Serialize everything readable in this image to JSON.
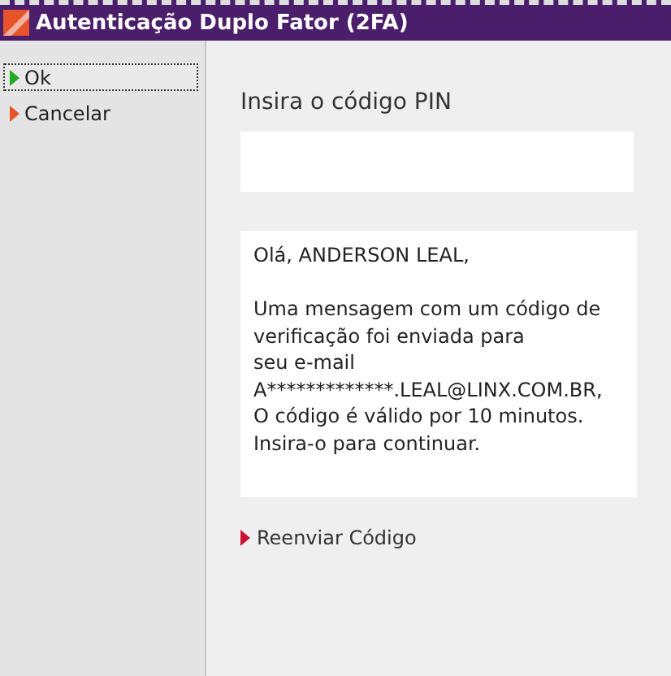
{
  "window": {
    "title": "Autenticação Duplo Fator (2FA)"
  },
  "sidebar": {
    "items": [
      {
        "label": "Ok",
        "color": "#22aa22",
        "selected": true
      },
      {
        "label": "Cancelar",
        "color": "#e8542a",
        "selected": false
      }
    ]
  },
  "pin": {
    "label": "Insira o código PIN"
  },
  "message": {
    "greeting": "Olá, ANDERSON LEAL,",
    "lines": [
      "Uma mensagem com um código de",
      "verificação foi enviada para",
      "seu e-mail",
      "A*************.LEAL@LINX.COM.BR,",
      "O código é válido por 10 minutos.",
      "Insira-o para continuar."
    ]
  },
  "resend": {
    "label": "Reenviar Código",
    "color": "#cc1133"
  }
}
